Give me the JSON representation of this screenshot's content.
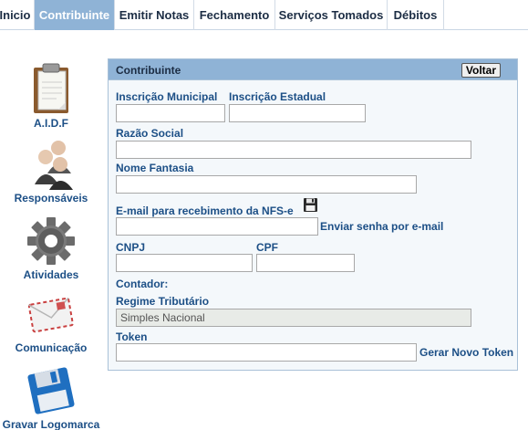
{
  "nav": {
    "tabs": [
      {
        "label": "Inicio"
      },
      {
        "label": "Contribuinte"
      },
      {
        "label": "Emitir Notas"
      },
      {
        "label": "Fechamento"
      },
      {
        "label": "Serviços Tomados"
      },
      {
        "label": "Débitos"
      }
    ],
    "active_tab": "Contribuinte"
  },
  "sidebar": {
    "items": [
      {
        "label": "A.I.D.F",
        "icon": "clipboard-icon"
      },
      {
        "label": "Responsáveis",
        "icon": "people-icon"
      },
      {
        "label": "Atividades",
        "icon": "gear-icon"
      },
      {
        "label": "Comunicação",
        "icon": "envelope-icon"
      },
      {
        "label": "Gravar Logomarca",
        "icon": "floppy-disk-icon"
      }
    ]
  },
  "panel": {
    "title": "Contribuinte",
    "back_label": "Voltar",
    "fields": {
      "inscricao_municipal": {
        "label": "Inscrição Municipal",
        "value": ""
      },
      "inscricao_estadual": {
        "label": "Inscrição Estadual",
        "value": ""
      },
      "razao_social": {
        "label": "Razão Social",
        "value": ""
      },
      "nome_fantasia": {
        "label": "Nome Fantasia",
        "value": ""
      },
      "email": {
        "label": "E-mail para recebimento da NFS-e",
        "value": "",
        "save_icon": "floppy-disk-icon"
      },
      "cnpj": {
        "label": "CNPJ",
        "value": ""
      },
      "cpf": {
        "label": "CPF",
        "value": ""
      },
      "contador": {
        "label": "Contador:"
      },
      "regime": {
        "label": "Regime Tributário",
        "value": "Simples Nacional"
      },
      "token": {
        "label": "Token",
        "value": ""
      }
    },
    "send_password_label": "Enviar senha por e-mail",
    "new_token_label": "Gerar Novo Token"
  },
  "colors": {
    "accent": "#8fb3d6",
    "label_blue": "#1c4f86",
    "panel_bg": "#f4f8fb",
    "readonly_bg": "#e8ebe7"
  }
}
